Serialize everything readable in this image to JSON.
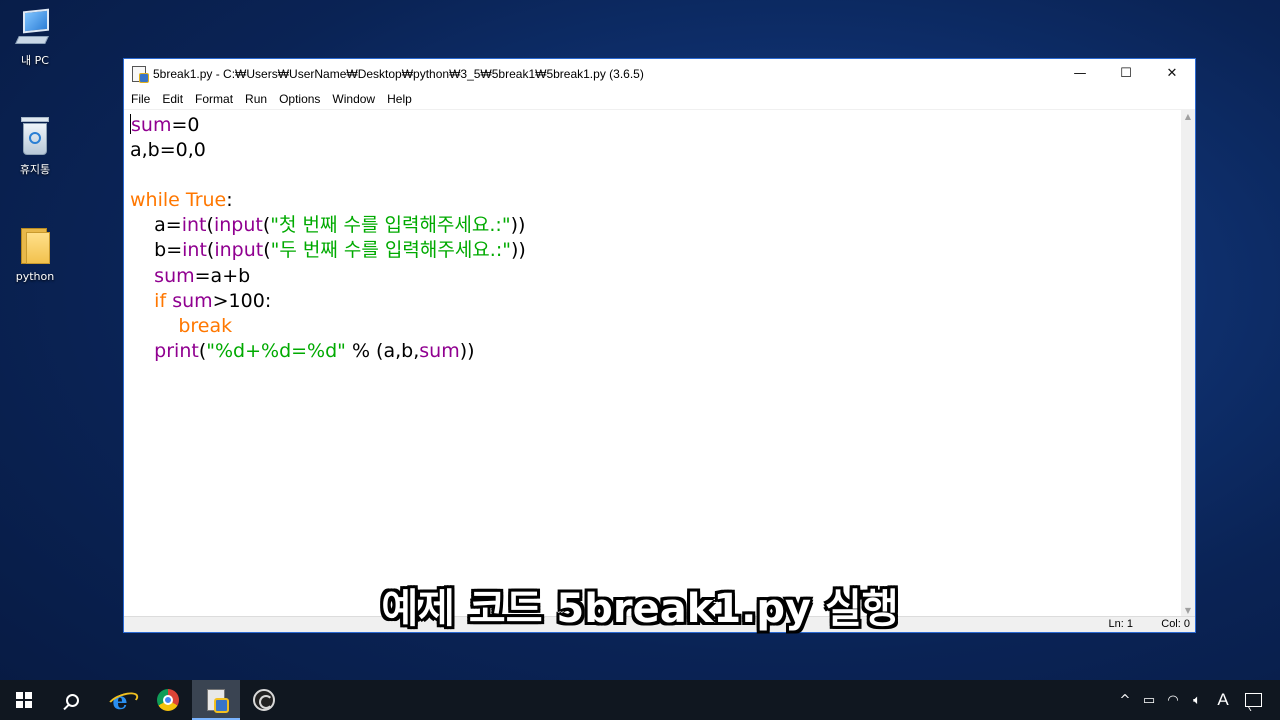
{
  "desktop": {
    "icons": [
      {
        "label": "내 PC",
        "icon": "computer-icon"
      },
      {
        "label": "휴지통",
        "icon": "recycle-bin-icon"
      },
      {
        "label": "python",
        "icon": "folder-icon"
      }
    ]
  },
  "window": {
    "title": "5break1.py - C:₩Users₩UserName₩Desktop₩python₩3_5₩5break1₩5break1.py (3.6.5)",
    "controls": {
      "minimize": "—",
      "maximize": "☐",
      "close": "✕"
    },
    "menu": [
      "File",
      "Edit",
      "Format",
      "Run",
      "Options",
      "Window",
      "Help"
    ],
    "code_lines": [
      "sum=0",
      "a,b=0,0",
      "",
      "while True:",
      "    a=int(input(\"첫 번째 수를 입력해주세요.:\"))",
      "    b=int(input(\"두 번째 수를 입력해주세요.:\"))",
      "    sum=a+b",
      "    if sum>100:",
      "        break",
      "    print(\"%d+%d=%d\" % (a,b,sum))"
    ],
    "status": {
      "line": "Ln: 1",
      "col": "Col: 0"
    },
    "colors": {
      "keyword": "#ff7700",
      "builtin": "#900090",
      "string": "#00aa00"
    }
  },
  "subtitle": "예제 코드 5break1.py 실행",
  "taskbar": {
    "apps": [
      "start-icon",
      "search-icon",
      "internet-explorer-icon",
      "chrome-icon",
      "python-idle-icon",
      "obs-icon"
    ],
    "active_app": "python-idle-icon",
    "tray": {
      "chevron": "^",
      "ime": "A"
    }
  }
}
